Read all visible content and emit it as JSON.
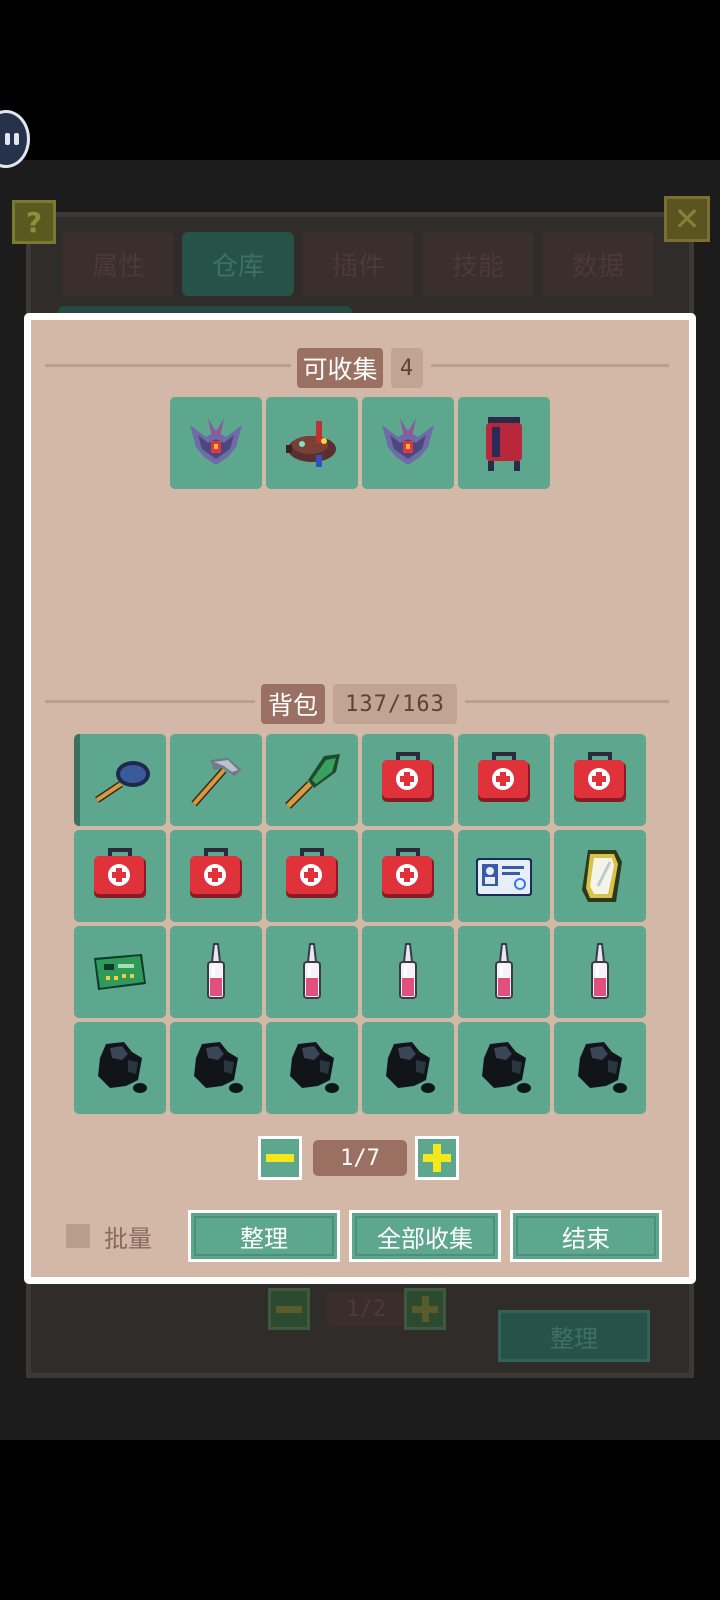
{
  "background": {
    "tabs": [
      "属性",
      "仓库",
      "插件",
      "技能",
      "数据"
    ],
    "active_tab": 1,
    "help_label": "?",
    "close_label": "✕",
    "page_label": "1/2",
    "sort_label": "整理"
  },
  "collectible": {
    "title": "可收集",
    "count": "4",
    "items": [
      {
        "icon": "spaceship-icon"
      },
      {
        "icon": "crab-mech-icon"
      },
      {
        "icon": "spaceship-icon"
      },
      {
        "icon": "canister-icon"
      }
    ]
  },
  "backpack": {
    "title": "背包",
    "count": "137/163",
    "items": [
      {
        "icon": "frying-pan-icon"
      },
      {
        "icon": "hammer-icon"
      },
      {
        "icon": "shovel-icon"
      },
      {
        "icon": "medkit-icon"
      },
      {
        "icon": "medkit-icon"
      },
      {
        "icon": "medkit-icon"
      },
      {
        "icon": "medkit-icon"
      },
      {
        "icon": "medkit-icon"
      },
      {
        "icon": "medkit-icon"
      },
      {
        "icon": "medkit-icon"
      },
      {
        "icon": "id-card-icon"
      },
      {
        "icon": "mirror-icon"
      },
      {
        "icon": "circuit-board-icon"
      },
      {
        "icon": "vial-icon"
      },
      {
        "icon": "vial-icon"
      },
      {
        "icon": "vial-icon"
      },
      {
        "icon": "vial-icon"
      },
      {
        "icon": "vial-icon"
      },
      {
        "icon": "coal-ore-icon"
      },
      {
        "icon": "coal-ore-icon"
      },
      {
        "icon": "coal-ore-icon"
      },
      {
        "icon": "coal-ore-icon"
      },
      {
        "icon": "coal-ore-icon"
      },
      {
        "icon": "coal-ore-icon"
      }
    ],
    "page_label": "1/7"
  },
  "footer": {
    "batch_label": "批量",
    "sort_label": "整理",
    "collect_all_label": "全部收集",
    "end_label": "结束"
  },
  "colors": {
    "slot": "#5ea78f",
    "panel": "#d3b8a7",
    "title_bg": "#9a7062",
    "plus_minus": "#f4e71c"
  }
}
